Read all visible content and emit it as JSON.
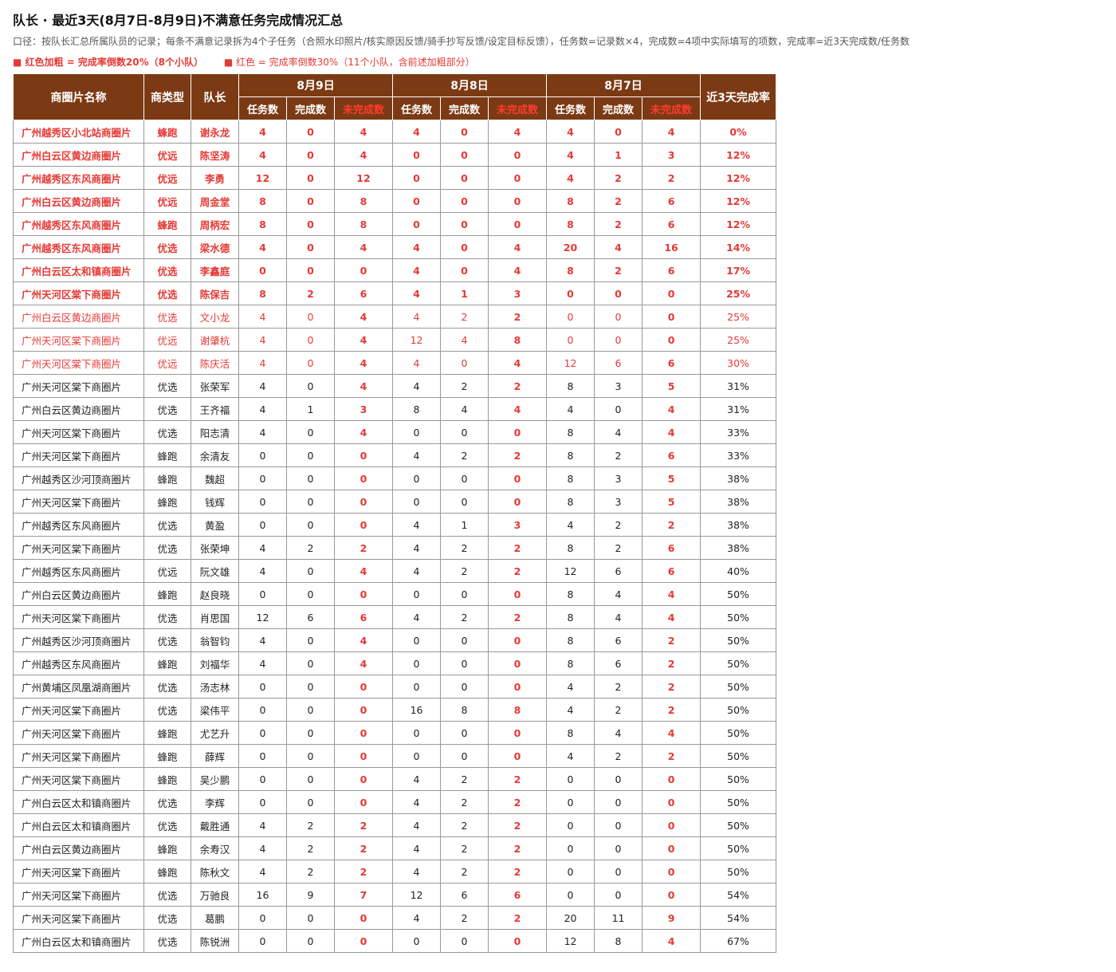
{
  "title": "队长 · 最近3天(8月7日-8月9日)不满意任务完成情况汇总",
  "note": "口径：按队长汇总所属队员的记录；每条不满意记录拆为4个子任务（合照水印照片/核实原因反馈/骑手抄写反馈/设定目标反馈），任务数=记录数×4，完成数=4项中实际填写的项数，完成率=近3天完成数/任务数",
  "legend": {
    "bold_red": "■ 红色加粗 = 完成率倒数20%（8个小队）",
    "red": "■ 红色 = 完成率倒数30%（11个小队，含前述加粗部分）"
  },
  "colors": {
    "header_bg": "#7b3a14",
    "red": "#e53935",
    "undone_header": "#ff3b30"
  },
  "headers": {
    "area": "商圈片名称",
    "type": "商类型",
    "leader": "队长",
    "day1": "8月9日",
    "day2": "8月8日",
    "day3": "8月7日",
    "tasks": "任务数",
    "done": "完成数",
    "undone": "未完成数",
    "rate": "近3天完成率"
  },
  "rows": [
    {
      "area": "广州越秀区小北站商圈片",
      "type": "蜂跑",
      "leader": "谢永龙",
      "d9": [
        "4",
        "0",
        "4"
      ],
      "d8": [
        "4",
        "0",
        "4"
      ],
      "d7": [
        "4",
        "0",
        "4"
      ],
      "rate": "0%",
      "style": "hb"
    },
    {
      "area": "广州白云区黄边商圈片",
      "type": "优远",
      "leader": "陈坚涛",
      "d9": [
        "4",
        "0",
        "4"
      ],
      "d8": [
        "0",
        "0",
        "0"
      ],
      "d7": [
        "4",
        "1",
        "3"
      ],
      "rate": "12%",
      "style": "hb"
    },
    {
      "area": "广州越秀区东风商圈片",
      "type": "优远",
      "leader": "李勇",
      "d9": [
        "12",
        "0",
        "12"
      ],
      "d8": [
        "0",
        "0",
        "0"
      ],
      "d7": [
        "4",
        "2",
        "2"
      ],
      "rate": "12%",
      "style": "hb"
    },
    {
      "area": "广州白云区黄边商圈片",
      "type": "优远",
      "leader": "周金堂",
      "d9": [
        "8",
        "0",
        "8"
      ],
      "d8": [
        "0",
        "0",
        "0"
      ],
      "d7": [
        "8",
        "2",
        "6"
      ],
      "rate": "12%",
      "style": "hb"
    },
    {
      "area": "广州越秀区东风商圈片",
      "type": "蜂跑",
      "leader": "周柄宏",
      "d9": [
        "8",
        "0",
        "8"
      ],
      "d8": [
        "0",
        "0",
        "0"
      ],
      "d7": [
        "8",
        "2",
        "6"
      ],
      "rate": "12%",
      "style": "hb"
    },
    {
      "area": "广州越秀区东风商圈片",
      "type": "优选",
      "leader": "梁水德",
      "d9": [
        "4",
        "0",
        "4"
      ],
      "d8": [
        "4",
        "0",
        "4"
      ],
      "d7": [
        "20",
        "4",
        "16"
      ],
      "rate": "14%",
      "style": "hb"
    },
    {
      "area": "广州白云区太和镇商圈片",
      "type": "优选",
      "leader": "李鑫庭",
      "d9": [
        "0",
        "0",
        "0"
      ],
      "d8": [
        "4",
        "0",
        "4"
      ],
      "d7": [
        "8",
        "2",
        "6"
      ],
      "rate": "17%",
      "style": "hb"
    },
    {
      "area": "广州天河区棠下商圈片",
      "type": "优选",
      "leader": "陈保吉",
      "d9": [
        "8",
        "2",
        "6"
      ],
      "d8": [
        "4",
        "1",
        "3"
      ],
      "d7": [
        "0",
        "0",
        "0"
      ],
      "rate": "25%",
      "style": "hb"
    },
    {
      "area": "广州白云区黄边商圈片",
      "type": "优选",
      "leader": "文小龙",
      "d9": [
        "4",
        "0",
        "4"
      ],
      "d8": [
        "4",
        "2",
        "2"
      ],
      "d7": [
        "0",
        "0",
        "0"
      ],
      "rate": "25%",
      "style": "hl"
    },
    {
      "area": "广州天河区棠下商圈片",
      "type": "优远",
      "leader": "谢肇杭",
      "d9": [
        "4",
        "0",
        "4"
      ],
      "d8": [
        "12",
        "4",
        "8"
      ],
      "d7": [
        "0",
        "0",
        "0"
      ],
      "rate": "25%",
      "style": "hl"
    },
    {
      "area": "广州天河区棠下商圈片",
      "type": "优远",
      "leader": "陈庆活",
      "d9": [
        "4",
        "0",
        "4"
      ],
      "d8": [
        "4",
        "0",
        "4"
      ],
      "d7": [
        "12",
        "6",
        "6"
      ],
      "rate": "30%",
      "style": "hl"
    },
    {
      "area": "广州天河区棠下商圈片",
      "type": "优选",
      "leader": "张荣军",
      "d9": [
        "4",
        "0",
        "4"
      ],
      "d8": [
        "4",
        "2",
        "2"
      ],
      "d7": [
        "8",
        "3",
        "5"
      ],
      "rate": "31%",
      "style": ""
    },
    {
      "area": "广州白云区黄边商圈片",
      "type": "优选",
      "leader": "王齐福",
      "d9": [
        "4",
        "1",
        "3"
      ],
      "d8": [
        "8",
        "4",
        "4"
      ],
      "d7": [
        "4",
        "0",
        "4"
      ],
      "rate": "31%",
      "style": ""
    },
    {
      "area": "广州天河区棠下商圈片",
      "type": "优选",
      "leader": "阳志清",
      "d9": [
        "4",
        "0",
        "4"
      ],
      "d8": [
        "0",
        "0",
        "0"
      ],
      "d7": [
        "8",
        "4",
        "4"
      ],
      "rate": "33%",
      "style": ""
    },
    {
      "area": "广州天河区棠下商圈片",
      "type": "蜂跑",
      "leader": "余清友",
      "d9": [
        "0",
        "0",
        "0"
      ],
      "d8": [
        "4",
        "2",
        "2"
      ],
      "d7": [
        "8",
        "2",
        "6"
      ],
      "rate": "33%",
      "style": ""
    },
    {
      "area": "广州越秀区沙河顶商圈片",
      "type": "蜂跑",
      "leader": "魏超",
      "d9": [
        "0",
        "0",
        "0"
      ],
      "d8": [
        "0",
        "0",
        "0"
      ],
      "d7": [
        "8",
        "3",
        "5"
      ],
      "rate": "38%",
      "style": ""
    },
    {
      "area": "广州天河区棠下商圈片",
      "type": "蜂跑",
      "leader": "钱辉",
      "d9": [
        "0",
        "0",
        "0"
      ],
      "d8": [
        "0",
        "0",
        "0"
      ],
      "d7": [
        "8",
        "3",
        "5"
      ],
      "rate": "38%",
      "style": ""
    },
    {
      "area": "广州越秀区东风商圈片",
      "type": "优选",
      "leader": "黄盈",
      "d9": [
        "0",
        "0",
        "0"
      ],
      "d8": [
        "4",
        "1",
        "3"
      ],
      "d7": [
        "4",
        "2",
        "2"
      ],
      "rate": "38%",
      "style": ""
    },
    {
      "area": "广州天河区棠下商圈片",
      "type": "优选",
      "leader": "张荣坤",
      "d9": [
        "4",
        "2",
        "2"
      ],
      "d8": [
        "4",
        "2",
        "2"
      ],
      "d7": [
        "8",
        "2",
        "6"
      ],
      "rate": "38%",
      "style": ""
    },
    {
      "area": "广州越秀区东风商圈片",
      "type": "优远",
      "leader": "阮文雄",
      "d9": [
        "4",
        "0",
        "4"
      ],
      "d8": [
        "4",
        "2",
        "2"
      ],
      "d7": [
        "12",
        "6",
        "6"
      ],
      "rate": "40%",
      "style": ""
    },
    {
      "area": "广州白云区黄边商圈片",
      "type": "蜂跑",
      "leader": "赵良晓",
      "d9": [
        "0",
        "0",
        "0"
      ],
      "d8": [
        "0",
        "0",
        "0"
      ],
      "d7": [
        "8",
        "4",
        "4"
      ],
      "rate": "50%",
      "style": ""
    },
    {
      "area": "广州天河区棠下商圈片",
      "type": "优选",
      "leader": "肖思国",
      "d9": [
        "12",
        "6",
        "6"
      ],
      "d8": [
        "4",
        "2",
        "2"
      ],
      "d7": [
        "8",
        "4",
        "4"
      ],
      "rate": "50%",
      "style": ""
    },
    {
      "area": "广州越秀区沙河顶商圈片",
      "type": "优选",
      "leader": "翁智钧",
      "d9": [
        "4",
        "0",
        "4"
      ],
      "d8": [
        "0",
        "0",
        "0"
      ],
      "d7": [
        "8",
        "6",
        "2"
      ],
      "rate": "50%",
      "style": ""
    },
    {
      "area": "广州越秀区东风商圈片",
      "type": "蜂跑",
      "leader": "刘福华",
      "d9": [
        "4",
        "0",
        "4"
      ],
      "d8": [
        "0",
        "0",
        "0"
      ],
      "d7": [
        "8",
        "6",
        "2"
      ],
      "rate": "50%",
      "style": ""
    },
    {
      "area": "广州黄埔区凤凰湖商圈片",
      "type": "优选",
      "leader": "汤志林",
      "d9": [
        "0",
        "0",
        "0"
      ],
      "d8": [
        "0",
        "0",
        "0"
      ],
      "d7": [
        "4",
        "2",
        "2"
      ],
      "rate": "50%",
      "style": ""
    },
    {
      "area": "广州天河区棠下商圈片",
      "type": "优选",
      "leader": "梁伟平",
      "d9": [
        "0",
        "0",
        "0"
      ],
      "d8": [
        "16",
        "8",
        "8"
      ],
      "d7": [
        "4",
        "2",
        "2"
      ],
      "rate": "50%",
      "style": ""
    },
    {
      "area": "广州天河区棠下商圈片",
      "type": "蜂跑",
      "leader": "尤艺升",
      "d9": [
        "0",
        "0",
        "0"
      ],
      "d8": [
        "0",
        "0",
        "0"
      ],
      "d7": [
        "8",
        "4",
        "4"
      ],
      "rate": "50%",
      "style": ""
    },
    {
      "area": "广州天河区棠下商圈片",
      "type": "蜂跑",
      "leader": "薛辉",
      "d9": [
        "0",
        "0",
        "0"
      ],
      "d8": [
        "0",
        "0",
        "0"
      ],
      "d7": [
        "4",
        "2",
        "2"
      ],
      "rate": "50%",
      "style": ""
    },
    {
      "area": "广州天河区棠下商圈片",
      "type": "蜂跑",
      "leader": "吴少鹏",
      "d9": [
        "0",
        "0",
        "0"
      ],
      "d8": [
        "4",
        "2",
        "2"
      ],
      "d7": [
        "0",
        "0",
        "0"
      ],
      "rate": "50%",
      "style": ""
    },
    {
      "area": "广州白云区太和镇商圈片",
      "type": "优选",
      "leader": "李辉",
      "d9": [
        "0",
        "0",
        "0"
      ],
      "d8": [
        "4",
        "2",
        "2"
      ],
      "d7": [
        "0",
        "0",
        "0"
      ],
      "rate": "50%",
      "style": ""
    },
    {
      "area": "广州白云区太和镇商圈片",
      "type": "优选",
      "leader": "戴胜通",
      "d9": [
        "4",
        "2",
        "2"
      ],
      "d8": [
        "4",
        "2",
        "2"
      ],
      "d7": [
        "0",
        "0",
        "0"
      ],
      "rate": "50%",
      "style": ""
    },
    {
      "area": "广州白云区黄边商圈片",
      "type": "蜂跑",
      "leader": "余寿汉",
      "d9": [
        "4",
        "2",
        "2"
      ],
      "d8": [
        "4",
        "2",
        "2"
      ],
      "d7": [
        "0",
        "0",
        "0"
      ],
      "rate": "50%",
      "style": ""
    },
    {
      "area": "广州天河区棠下商圈片",
      "type": "蜂跑",
      "leader": "陈秋文",
      "d9": [
        "4",
        "2",
        "2"
      ],
      "d8": [
        "4",
        "2",
        "2"
      ],
      "d7": [
        "0",
        "0",
        "0"
      ],
      "rate": "50%",
      "style": ""
    },
    {
      "area": "广州天河区棠下商圈片",
      "type": "优选",
      "leader": "万驰良",
      "d9": [
        "16",
        "9",
        "7"
      ],
      "d8": [
        "12",
        "6",
        "6"
      ],
      "d7": [
        "0",
        "0",
        "0"
      ],
      "rate": "54%",
      "style": ""
    },
    {
      "area": "广州天河区棠下商圈片",
      "type": "优选",
      "leader": "葛鹏",
      "d9": [
        "0",
        "0",
        "0"
      ],
      "d8": [
        "4",
        "2",
        "2"
      ],
      "d7": [
        "20",
        "11",
        "9"
      ],
      "rate": "54%",
      "style": ""
    },
    {
      "area": "广州白云区太和镇商圈片",
      "type": "优选",
      "leader": "陈锐洲",
      "d9": [
        "0",
        "0",
        "0"
      ],
      "d8": [
        "0",
        "0",
        "0"
      ],
      "d7": [
        "12",
        "8",
        "4"
      ],
      "rate": "67%",
      "style": ""
    }
  ]
}
